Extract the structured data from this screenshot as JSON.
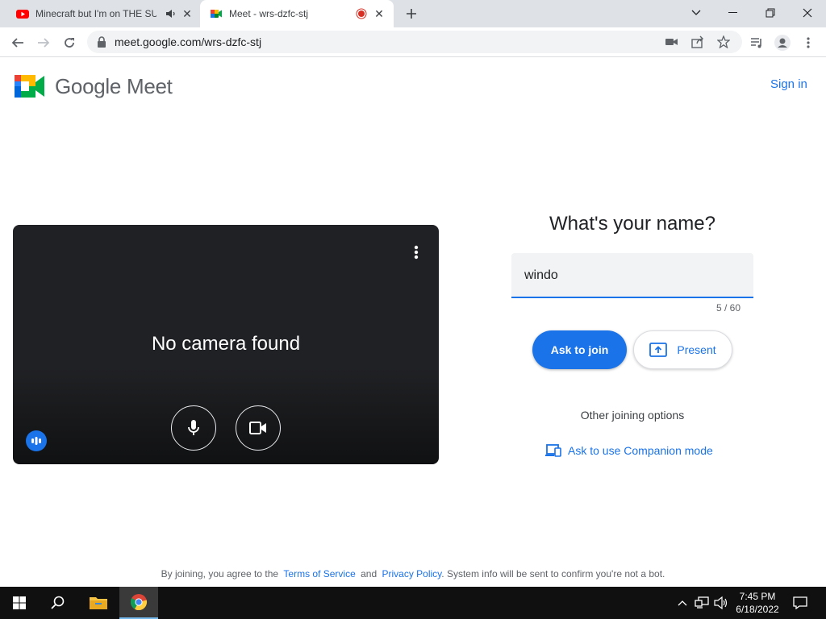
{
  "browser": {
    "tabs": [
      {
        "title": "Minecraft but I'm on THE SUN",
        "favicon": "youtube-icon",
        "audio_icon": "speaker-icon",
        "close_icon": "close-icon"
      },
      {
        "title": "Meet - wrs-dzfc-stj",
        "favicon": "google-meet-icon",
        "recording_icon": "record-dot-icon",
        "close_icon": "close-icon"
      }
    ],
    "new_tab_icon": "plus-icon",
    "window_controls": [
      "chevron-down-icon",
      "minimize-icon",
      "restore-icon",
      "close-icon"
    ],
    "toolbar": {
      "back_icon": "back-arrow-icon",
      "forward_icon": "forward-arrow-icon",
      "reload_icon": "reload-icon",
      "url": "meet.google.com/wrs-dzfc-stj",
      "right_icons": [
        "camera-icon",
        "share-icon",
        "star-icon",
        "reading-list-icon",
        "profile-icon",
        "more-vert-icon"
      ]
    }
  },
  "meet": {
    "brand": "Google Meet",
    "sign_in": "Sign in",
    "preview": {
      "status": "No camera found",
      "mic_icon": "mic-icon",
      "camera_icon": "videocam-icon",
      "menu_icon": "more-vert-icon",
      "audio_indicator_icon": "audio-level-icon"
    },
    "join": {
      "title": "What's your name?",
      "name_value": "windo",
      "counter": "5 / 60",
      "ask_to_join": "Ask to join",
      "present": "Present",
      "other_options": "Other joining options",
      "companion": "Ask to use Companion mode"
    },
    "legal": {
      "prefix": "By joining, you agree to the",
      "terms": "Terms of Service",
      "and": "and",
      "privacy": "Privacy Policy",
      "suffix": ". System info will be sent to confirm you're not a bot."
    },
    "colors": {
      "accent": "#1a73e8",
      "preview_bg": "#202124"
    }
  },
  "taskbar": {
    "start_icon": "windows-start-icon",
    "search_icon": "search-icon",
    "apps": [
      "file-explorer-icon",
      "chrome-icon"
    ],
    "tray": [
      "chevron-up-icon",
      "network-icon",
      "volume-icon"
    ],
    "time": "7:45 PM",
    "date": "6/18/2022",
    "notification_icon": "notification-icon"
  }
}
